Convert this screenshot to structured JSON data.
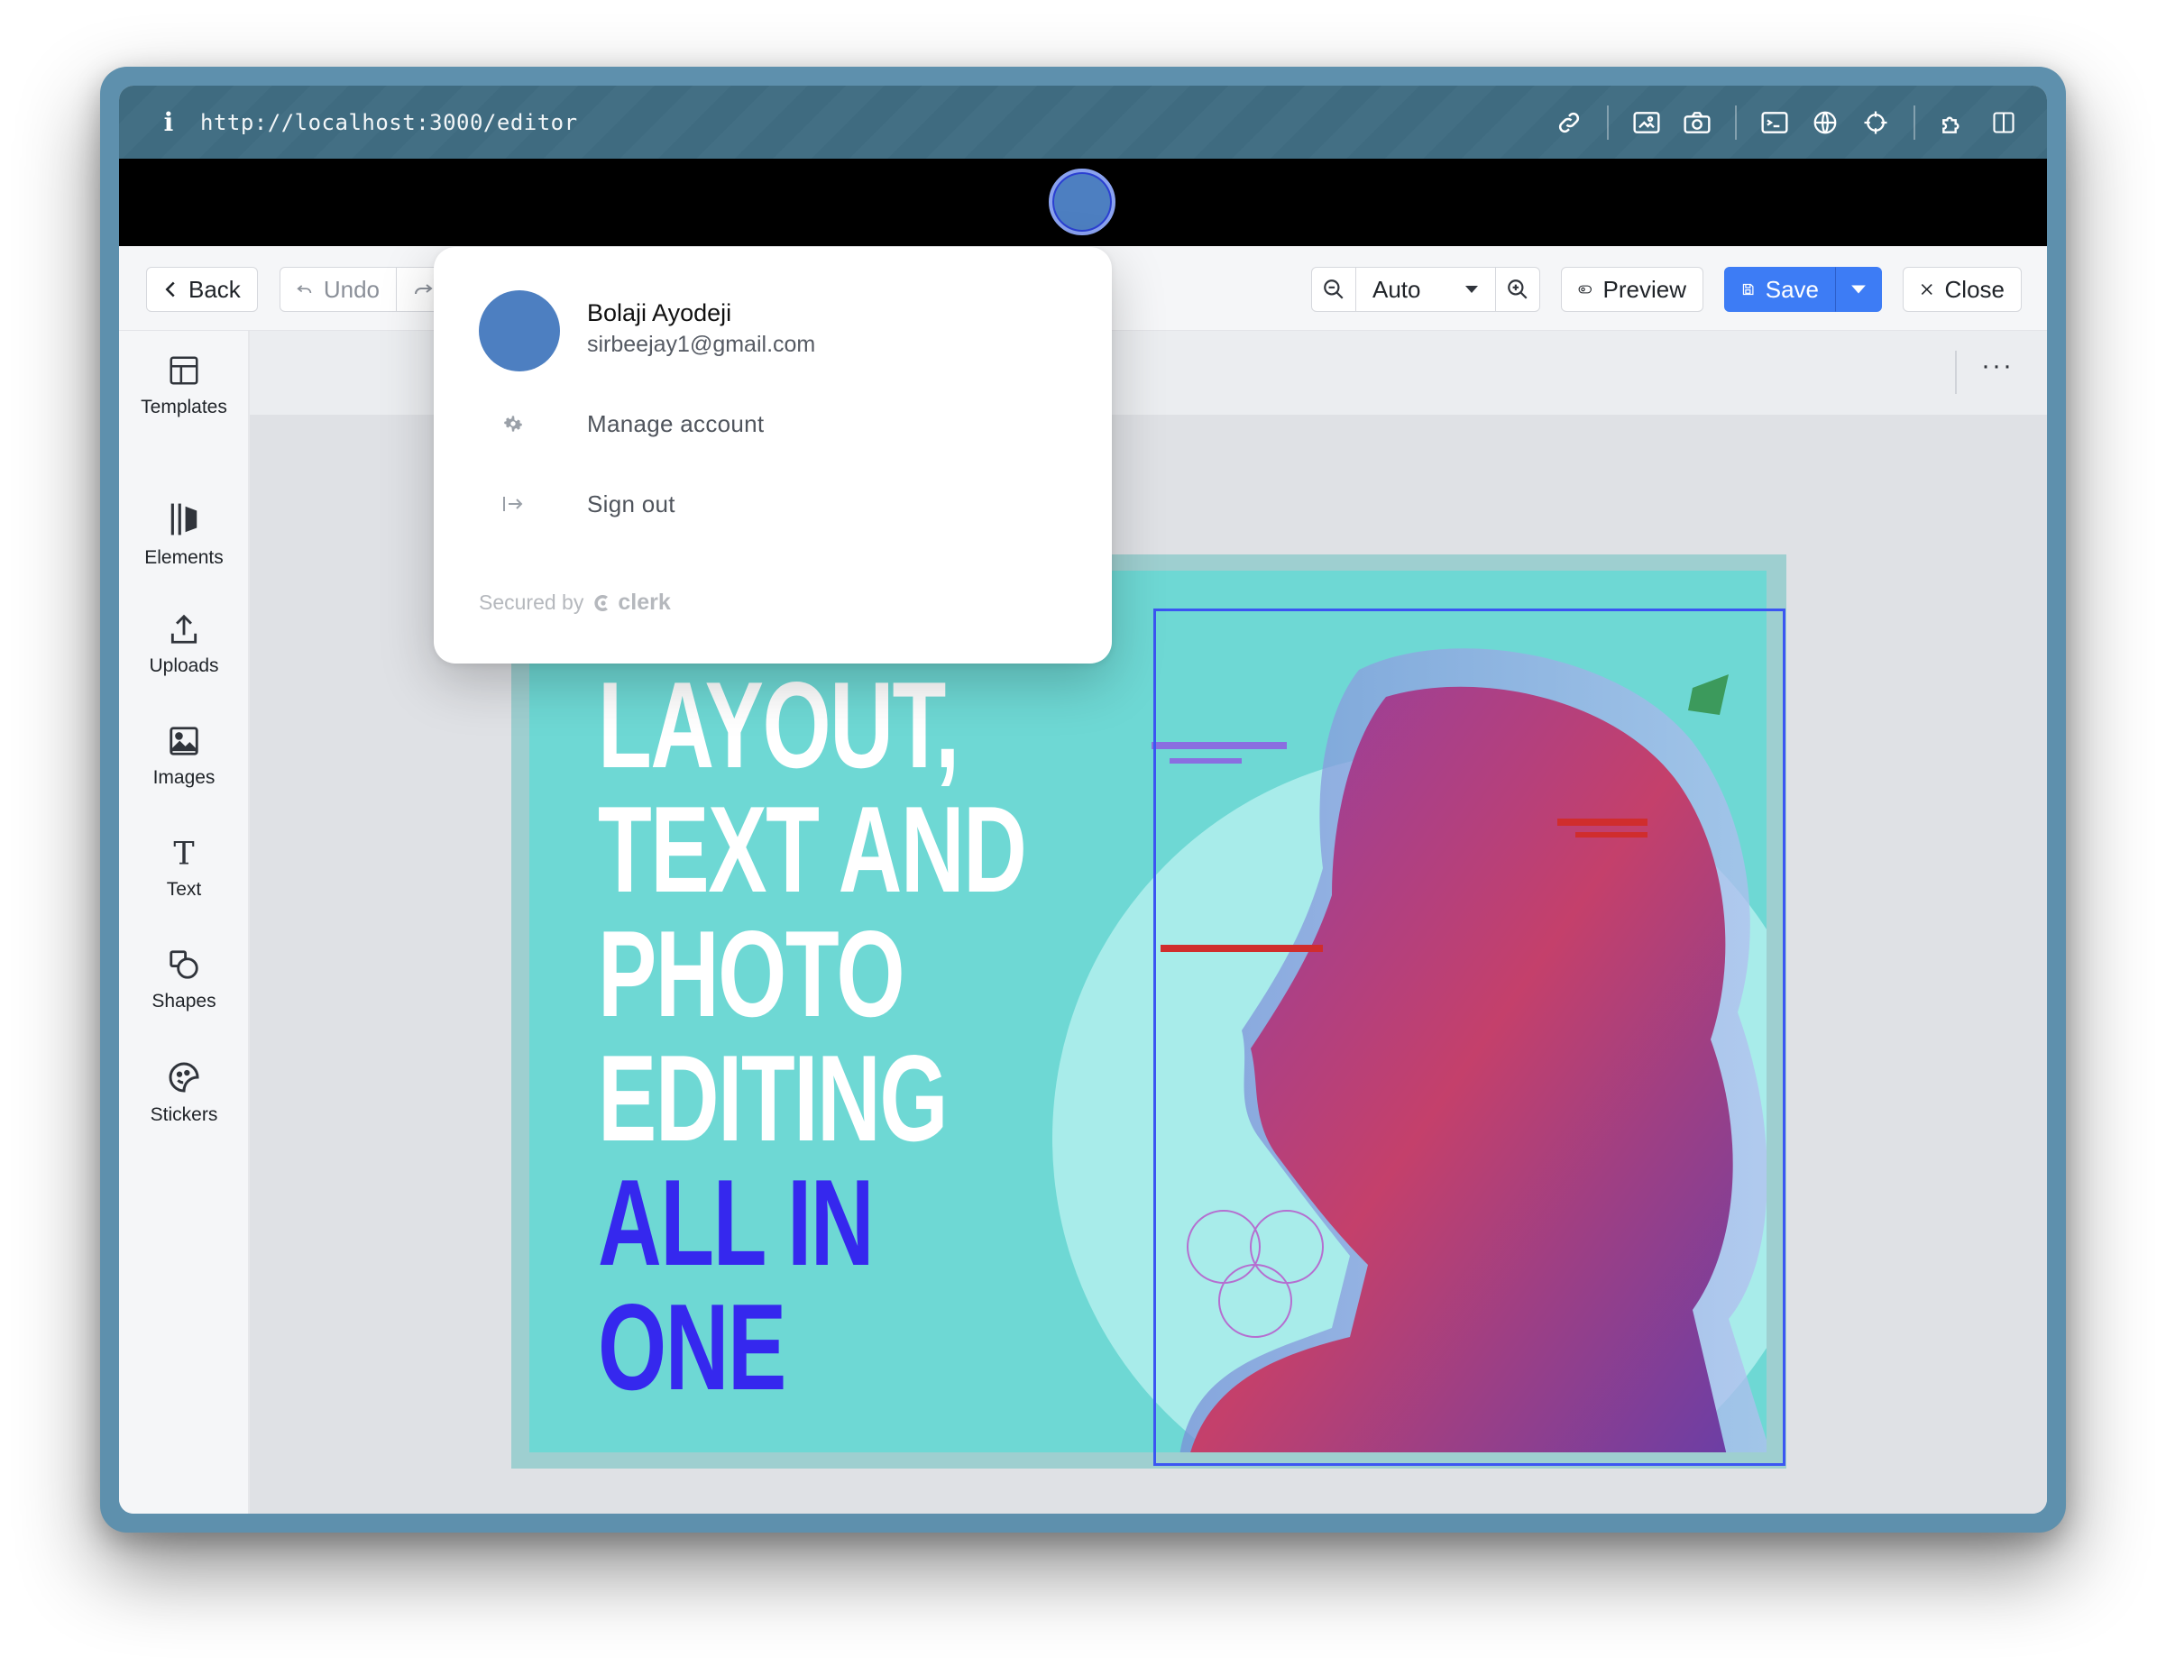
{
  "browser": {
    "url": "http://localhost:3000/editor",
    "info_glyph": "i",
    "tools": [
      "link-icon",
      "screenshot-icon",
      "camera-icon",
      "terminal-icon",
      "globe-icon",
      "crosshair-icon",
      "extension-icon",
      "sidebar-toggle-icon"
    ]
  },
  "toolbar": {
    "back_label": "Back",
    "undo_label": "Undo",
    "zoom_value": "Auto",
    "preview_label": "Preview",
    "save_label": "Save",
    "close_label": "Close"
  },
  "sidebar": {
    "items": [
      {
        "label": "Templates",
        "icon": "templates-icon"
      },
      {
        "label": "Elements",
        "icon": "elements-icon"
      },
      {
        "label": "Uploads",
        "icon": "upload-icon"
      },
      {
        "label": "Images",
        "icon": "image-icon"
      },
      {
        "label": "Text",
        "icon": "text-icon"
      },
      {
        "label": "Shapes",
        "icon": "shapes-icon"
      },
      {
        "label": "Stickers",
        "icon": "sticker-icon"
      }
    ]
  },
  "subbar": {
    "more_label": "···"
  },
  "design": {
    "lines_white": [
      "LAYOUT,",
      "TEXT AND",
      "PHOTO",
      "EDITING"
    ],
    "lines_blue": [
      "ALL IN",
      "ONE"
    ]
  },
  "account_popup": {
    "name": "Bolaji Ayodeji",
    "email": "sirbeejay1@gmail.com",
    "manage_label": "Manage account",
    "signout_label": "Sign out",
    "secured_by": "Secured by",
    "brand": "clerk"
  },
  "colors": {
    "accent": "#3d7cf5",
    "avatar": "#4d7fc1",
    "canvas_bg": "#6ed8d4",
    "headline_blue": "#3528ee"
  }
}
